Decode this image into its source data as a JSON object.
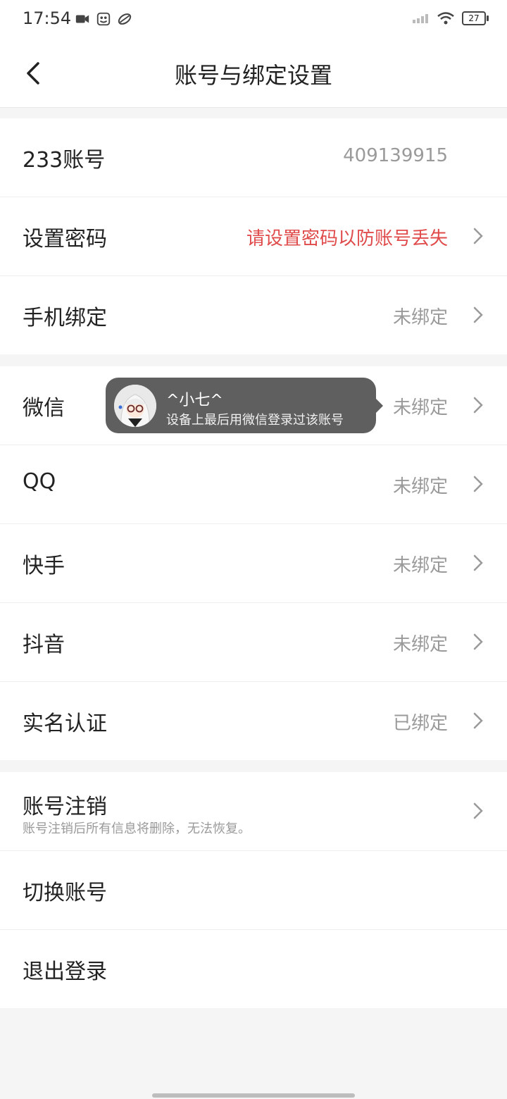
{
  "status": {
    "time": "17:54",
    "battery": "27"
  },
  "header": {
    "title": "账号与绑定设置"
  },
  "group1": [
    {
      "label": "233账号",
      "value": "409139915"
    },
    {
      "label": "设置密码",
      "value": "请设置密码以防账号丢失"
    },
    {
      "label": "手机绑定",
      "value": "未绑定"
    }
  ],
  "group2": [
    {
      "label": "微信",
      "value": "未绑定"
    },
    {
      "label": "QQ",
      "value": "未绑定"
    },
    {
      "label": "快手",
      "value": "未绑定"
    },
    {
      "label": "抖音",
      "value": "未绑定"
    },
    {
      "label": "实名认证",
      "value": "已绑定"
    }
  ],
  "group3": {
    "cancel": {
      "label": "账号注销",
      "sub": "账号注销后所有信息将删除，无法恢复。"
    },
    "switch": {
      "label": "切换账号"
    },
    "logout": {
      "label": "退出登录"
    }
  },
  "toast": {
    "name": "^小七^",
    "desc": "设备上最后用微信登录过该账号"
  },
  "colors": {
    "warning": "#e04b4b",
    "muted": "#9a9a9a",
    "toast_bg": "#5f5f5f"
  }
}
